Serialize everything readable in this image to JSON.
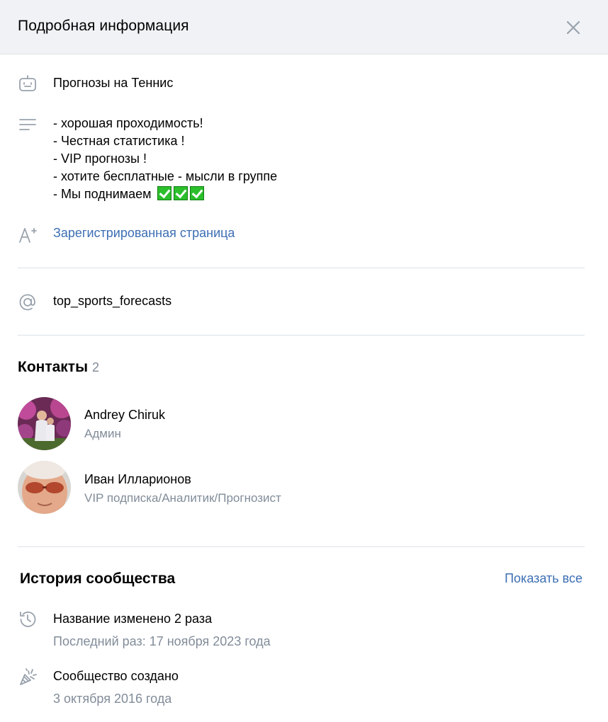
{
  "header": {
    "title": "Подробная информация"
  },
  "info": {
    "category": "Прогнозы на Теннис",
    "description": [
      "- хорошая проходимость!",
      "- Честная статистика !",
      "- VIP прогнозы !",
      "- хотите бесплатные - мысли в группе",
      "- Мы поднимаем"
    ],
    "registered_link": "Зарегистрированная страница",
    "address": "top_sports_forecasts"
  },
  "contacts": {
    "title": "Контакты",
    "count": "2",
    "items": [
      {
        "name": "Andrey Chiruk",
        "role": "Админ"
      },
      {
        "name": "Иван Илларионов",
        "role": "VIP подписка/Аналитик/Прогнозист"
      }
    ]
  },
  "history": {
    "title": "История сообщества",
    "show_all": "Показать все",
    "items": [
      {
        "title": "Название изменено 2 раза",
        "sub": "Последний раз: 17 ноября 2023 года"
      },
      {
        "title": "Сообщество создано",
        "sub": "3 октября 2016 года"
      }
    ]
  },
  "colors": {
    "link": "#3d6fb4",
    "secondary_text": "#818c99",
    "header_bg": "#f0f2f5",
    "check_green": "#2bbf2b"
  }
}
